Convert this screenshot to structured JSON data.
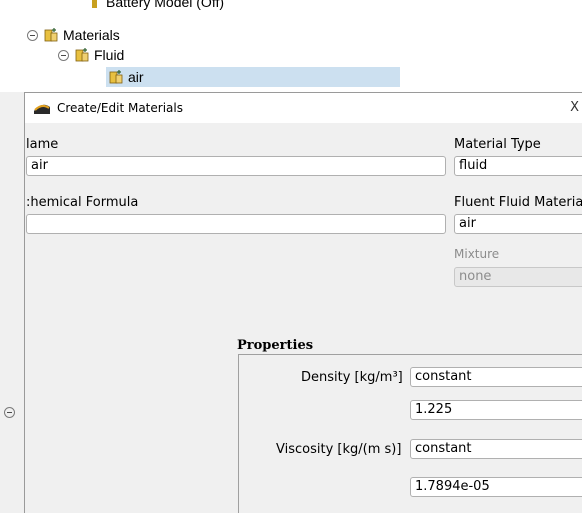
{
  "tree": {
    "partial_row": "Battery Model (Off)",
    "materials_label": "Materials",
    "fluid_label": "Fluid",
    "air_label": "air"
  },
  "dialog": {
    "title": "Create/Edit Materials",
    "close_glyph": "X",
    "name_label": "lame",
    "name_value": "air",
    "formula_label": ":hemical Formula",
    "formula_value": "",
    "material_type_label": "Material Type",
    "material_type_value": "fluid",
    "fluent_fluid_label": "Fluent Fluid Materia",
    "fluent_fluid_value": "air",
    "mixture_label": "Mixture",
    "mixture_value": "none",
    "properties_title": "Properties",
    "density_label": "Density [kg/m³]",
    "density_method": "constant",
    "density_value": "1.225",
    "viscosity_label": "Viscosity [kg/(m s)]",
    "viscosity_method": "constant",
    "viscosity_value": "1.7894e-05"
  },
  "colors": {
    "selection": "#cce0f0",
    "dialog_bg": "#f0f0f0",
    "disabled_text": "#8c8c8c"
  }
}
